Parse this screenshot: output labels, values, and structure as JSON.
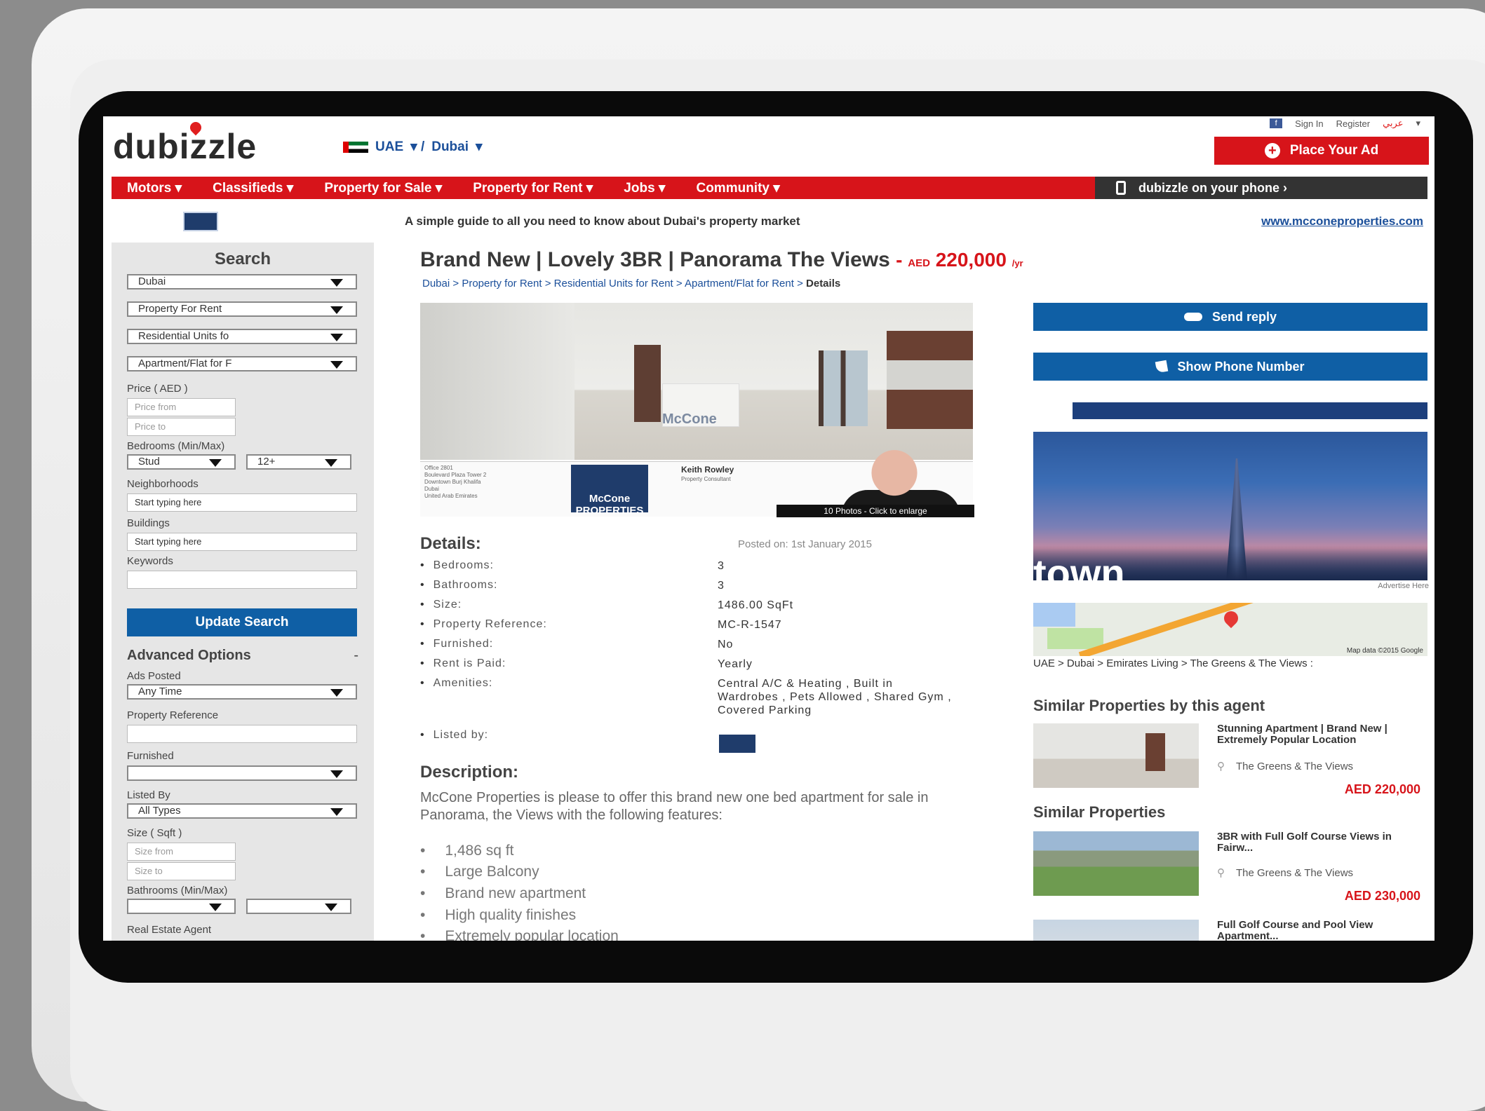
{
  "header": {
    "logo": "dubizzle",
    "country": "UAE",
    "city": "Dubai",
    "sign_in": "Sign In",
    "register": "Register",
    "arabic": "عربي",
    "place_ad": "Place Your Ad"
  },
  "nav": {
    "items": [
      "Motors ▾",
      "Classifieds ▾",
      "Property for Sale ▾",
      "Property for Rent ▾",
      "Jobs ▾",
      "Community ▾"
    ],
    "phone": "dubizzle on your phone ›"
  },
  "promo": {
    "text": "A simple guide to all you need to know about Dubai's property market",
    "url": "www.mcconeproperties.com"
  },
  "search": {
    "title": "Search",
    "city": "Dubai",
    "category": "Property For Rent",
    "subcategory": "Residential Units fo",
    "type": "Apartment/Flat for F",
    "price_label": "Price ( AED )",
    "price_from": "Price from",
    "price_to": "Price to",
    "bedrooms_label": "Bedrooms (Min/Max)",
    "bed_min": "Stud",
    "bed_max": "12+",
    "neighborhoods_label": "Neighborhoods",
    "neighborhoods_placeholder": "Start typing here",
    "buildings_label": "Buildings",
    "buildings_placeholder": "Start typing here",
    "keywords_label": "Keywords",
    "update": "Update Search",
    "advanced": "Advanced Options",
    "advanced_toggle": "-",
    "ads_posted_label": "Ads Posted",
    "ads_posted": "Any Time",
    "property_ref_label": "Property Reference",
    "furnished_label": "Furnished",
    "listed_by_label": "Listed By",
    "listed_by": "All Types",
    "size_label": "Size ( Sqft )",
    "size_from": "Size from",
    "size_to": "Size to",
    "bathrooms_label": "Bathrooms (Min/Max)",
    "agent_label": "Real Estate Agent"
  },
  "listing": {
    "title": "Brand New | Lovely 3BR | Panorama The Views",
    "price_currency": "AED",
    "price": "220,000",
    "price_period": "/yr",
    "breadcrumbs": [
      "Dubai",
      "Property for Rent",
      "Residential Units for Rent",
      "Apartment/Flat for Rent"
    ],
    "breadcrumb_current": "Details",
    "photo_watermark": "McCone",
    "agent_name": "Keith Rowley",
    "agent_title": "Property Consultant",
    "agency": "McCone PROPERTIES",
    "photos_badge": "10 Photos - Click to enlarge",
    "details_title": "Details:",
    "posted": "Posted on: 1st January 2015",
    "details": [
      {
        "label": "Bedrooms:",
        "value": "3"
      },
      {
        "label": "Bathrooms:",
        "value": "3"
      },
      {
        "label": "Size:",
        "value": "1486.00 SqFt"
      },
      {
        "label": "Property Reference:",
        "value": "MC-R-1547"
      },
      {
        "label": "Furnished:",
        "value": "No"
      },
      {
        "label": "Rent is Paid:",
        "value": "Yearly"
      },
      {
        "label": "Amenities:",
        "value": "Central A/C & Heating , Built in Wardrobes , Pets Allowed , Shared Gym , Covered Parking"
      },
      {
        "label": "Listed by:",
        "value": ""
      }
    ],
    "description_title": "Description:",
    "description": "McCone Properties is please to offer this brand new one bed apartment for sale in Panorama, the Views with the following features:",
    "features": [
      "1,486 sq ft",
      "Large Balcony",
      "Brand new apartment",
      "High quality finishes",
      "Extremely popular location"
    ]
  },
  "actions": {
    "send_reply": "Send reply",
    "show_phone": "Show Phone Number"
  },
  "banner": {
    "text": "town",
    "advertise": "Advertise Here"
  },
  "map": {
    "data": "Map data ©2015 Google",
    "location": "UAE > Dubai > Emirates Living > The Greens & The Views :"
  },
  "similar_agent": {
    "title": "Similar Properties by this agent",
    "items": [
      {
        "title": "Stunning Apartment | Brand New | Extremely Popular Location",
        "location": "The Greens & The Views",
        "price": "AED 220,000"
      }
    ]
  },
  "similar": {
    "title": "Similar Properties",
    "items": [
      {
        "title": "3BR with Full Golf Course Views in Fairw...",
        "location": "The Greens & The Views",
        "price": "AED 230,000"
      },
      {
        "title": "Full Golf Course and Pool View Apartment...",
        "location": "",
        "price": ""
      }
    ]
  }
}
